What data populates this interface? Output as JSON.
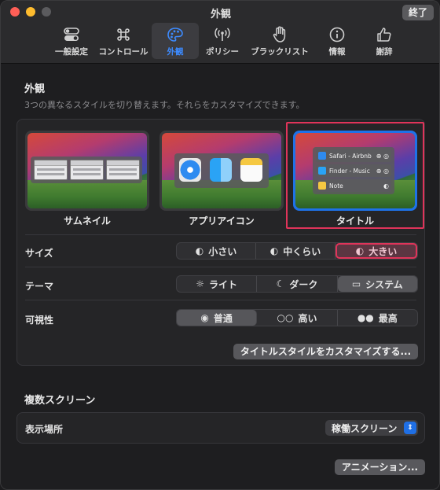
{
  "window": {
    "title": "外観",
    "quit_label": "終了"
  },
  "toolbar": {
    "items": [
      {
        "label": "一般設定",
        "icon": "toggles-icon"
      },
      {
        "label": "コントロール",
        "icon": "command-icon"
      },
      {
        "label": "外観",
        "icon": "palette-icon",
        "active": true
      },
      {
        "label": "ポリシー",
        "icon": "antenna-icon"
      },
      {
        "label": "ブラックリスト",
        "icon": "hand-icon"
      },
      {
        "label": "情報",
        "icon": "info-icon"
      },
      {
        "label": "謝辞",
        "icon": "thumbs-up-icon"
      }
    ]
  },
  "appearance": {
    "title": "外観",
    "description": "3つの異なるスタイルを切り替えます。それらをカスタマイズできます。",
    "styles": [
      {
        "label": "サムネイル"
      },
      {
        "label": "アプリアイコン"
      },
      {
        "label": "タイトル",
        "selected": true
      }
    ],
    "title_preview_rows": [
      {
        "text": "Safari - Airbnb",
        "controls": "⊕ ◎"
      },
      {
        "text": "Finder - Music",
        "controls": "⊕ ◎"
      },
      {
        "text": "Note",
        "controls": "◐"
      }
    ],
    "size": {
      "label": "サイズ",
      "options": [
        "小さい",
        "中くらい",
        "大きい"
      ],
      "selected": "大きい"
    },
    "theme": {
      "label": "テーマ",
      "options": [
        "ライト",
        "ダーク",
        "システム"
      ],
      "selected": "システム"
    },
    "visibility": {
      "label": "可視性",
      "options": [
        "普通",
        "高い",
        "最高"
      ],
      "selected": "普通"
    },
    "customize_button": "タイトルスタイルをカスタマイズする..."
  },
  "multi_screen": {
    "title": "複数スクリーン",
    "display_label": "表示場所",
    "display_value": "稼働スクリーン"
  },
  "animation_button": "アニメーション...",
  "colors": {
    "accent": "#1f6fe5",
    "highlight": "#e0345a",
    "active_tab_label": "#3d8bff"
  }
}
